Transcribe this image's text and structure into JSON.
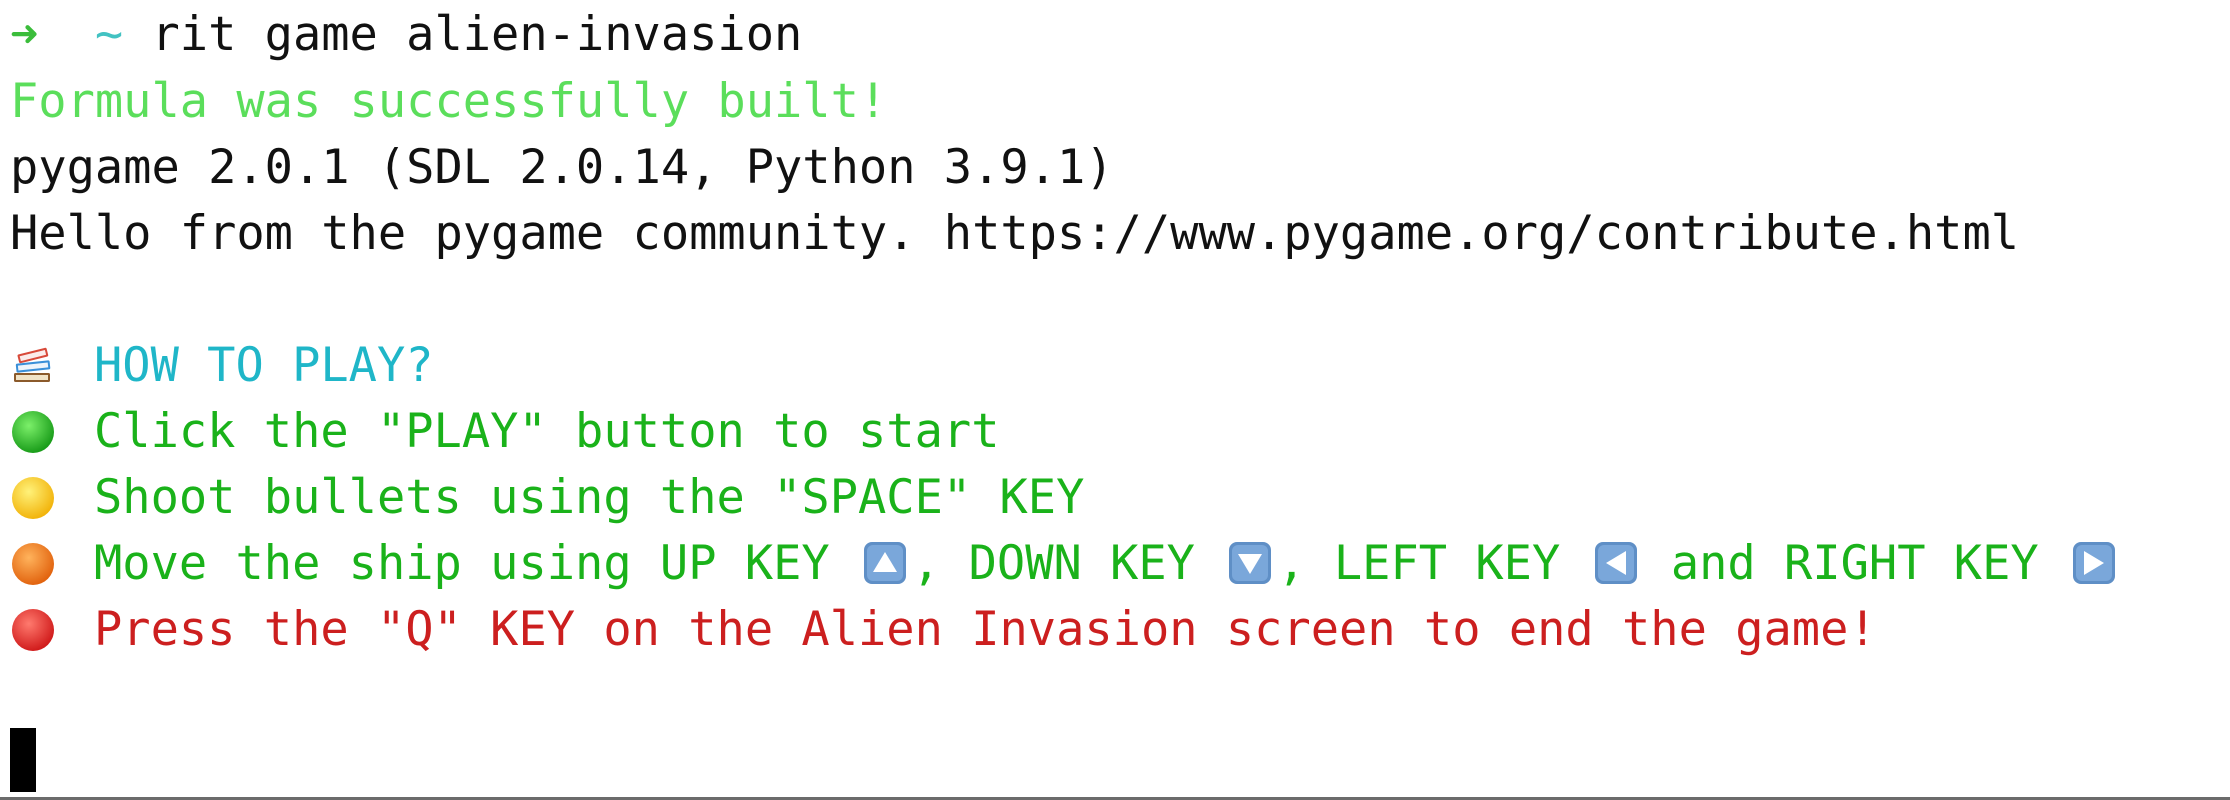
{
  "prompt": {
    "arrow": "➜",
    "cwd": "~",
    "command": "rit game alien-invasion"
  },
  "output": {
    "success": "Formula was successfully built!",
    "pygame_version": "pygame 2.0.1 (SDL 2.0.14, Python 3.9.1)",
    "pygame_hello": "Hello from the pygame community. https://www.pygame.org/contribute.html"
  },
  "instructions": {
    "heading": "HOW TO PLAY?",
    "heading_icon": "books-icon",
    "play": {
      "icon": "green-circle-icon",
      "text": "Click the \"PLAY\" button to start"
    },
    "shoot": {
      "icon": "yellow-circle-icon",
      "text": "Shoot bullets using the \"SPACE\" KEY"
    },
    "move": {
      "icon": "orange-circle-icon",
      "part1": "Move the ship using UP KEY",
      "part2": ", DOWN KEY",
      "part3": ", LEFT KEY",
      "part4": " and RIGHT KEY",
      "up_icon": "up-arrow-key-icon",
      "down_icon": "down-arrow-key-icon",
      "left_icon": "left-arrow-key-icon",
      "right_icon": "right-arrow-key-icon"
    },
    "quit": {
      "icon": "red-circle-icon",
      "text": "Press the \"Q\" KEY on the Alien Invasion screen to end the game!"
    }
  },
  "colors": {
    "prompt_arrow": "#3bbd3b",
    "success_green": "#5bde5b",
    "heading_cyan": "#1fb6c8",
    "instruction_green": "#1ab21a",
    "warning_red": "#cc1f1f",
    "background": "#ffffff"
  }
}
